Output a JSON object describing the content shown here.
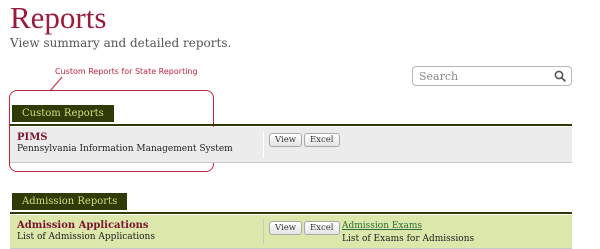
{
  "page": {
    "title": "Reports",
    "subtitle": "View summary and detailed reports."
  },
  "annotation": {
    "label": "Custom Reports for State Reporting"
  },
  "search": {
    "placeholder": "Search",
    "icon": "magnifier"
  },
  "sections": [
    {
      "heading": "Custom Reports",
      "rows": [
        {
          "name": "PIMS",
          "description": "Pennsylvania Information Management System",
          "buttons": [
            "View",
            "Excel"
          ]
        }
      ]
    },
    {
      "heading": "Admission Reports",
      "rows": [
        {
          "name": "Admission Applications",
          "description": "List of Admission Applications",
          "buttons": [
            "View",
            "Excel"
          ],
          "secondary_link": "Admission Exams",
          "secondary_description": "List of Exams for Admissions"
        }
      ]
    }
  ],
  "colors": {
    "title": "#9a1b3c",
    "section_tab_bg": "#2f3b06",
    "section_tab_text": "#d3df7c",
    "annotation": "#c0253d",
    "row_grey": "#ececec",
    "row_green": "#dce8ab",
    "link": "#2e6b3c"
  }
}
